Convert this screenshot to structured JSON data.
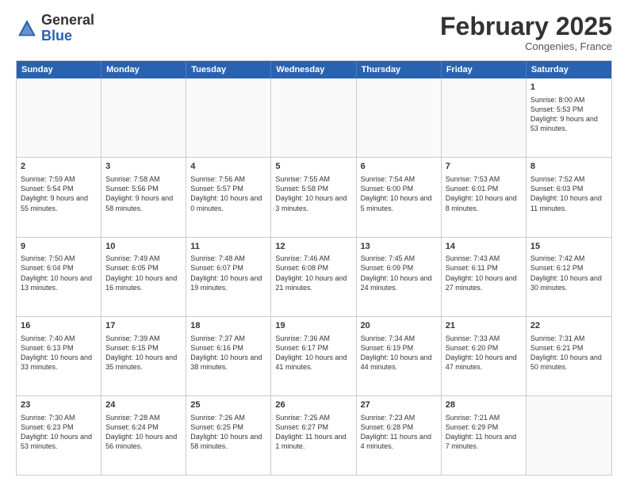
{
  "header": {
    "logo": {
      "general": "General",
      "blue": "Blue"
    },
    "title": "February 2025",
    "location": "Congenies, France"
  },
  "weekdays": [
    "Sunday",
    "Monday",
    "Tuesday",
    "Wednesday",
    "Thursday",
    "Friday",
    "Saturday"
  ],
  "weeks": [
    [
      {
        "day": "",
        "empty": true
      },
      {
        "day": "",
        "empty": true
      },
      {
        "day": "",
        "empty": true
      },
      {
        "day": "",
        "empty": true
      },
      {
        "day": "",
        "empty": true
      },
      {
        "day": "",
        "empty": true
      },
      {
        "day": "1",
        "sunrise": "Sunrise: 8:00 AM",
        "sunset": "Sunset: 5:53 PM",
        "daylight": "Daylight: 9 hours and 53 minutes."
      }
    ],
    [
      {
        "day": "2",
        "sunrise": "Sunrise: 7:59 AM",
        "sunset": "Sunset: 5:54 PM",
        "daylight": "Daylight: 9 hours and 55 minutes."
      },
      {
        "day": "3",
        "sunrise": "Sunrise: 7:58 AM",
        "sunset": "Sunset: 5:56 PM",
        "daylight": "Daylight: 9 hours and 58 minutes."
      },
      {
        "day": "4",
        "sunrise": "Sunrise: 7:56 AM",
        "sunset": "Sunset: 5:57 PM",
        "daylight": "Daylight: 10 hours and 0 minutes."
      },
      {
        "day": "5",
        "sunrise": "Sunrise: 7:55 AM",
        "sunset": "Sunset: 5:58 PM",
        "daylight": "Daylight: 10 hours and 3 minutes."
      },
      {
        "day": "6",
        "sunrise": "Sunrise: 7:54 AM",
        "sunset": "Sunset: 6:00 PM",
        "daylight": "Daylight: 10 hours and 5 minutes."
      },
      {
        "day": "7",
        "sunrise": "Sunrise: 7:53 AM",
        "sunset": "Sunset: 6:01 PM",
        "daylight": "Daylight: 10 hours and 8 minutes."
      },
      {
        "day": "8",
        "sunrise": "Sunrise: 7:52 AM",
        "sunset": "Sunset: 6:03 PM",
        "daylight": "Daylight: 10 hours and 11 minutes."
      }
    ],
    [
      {
        "day": "9",
        "sunrise": "Sunrise: 7:50 AM",
        "sunset": "Sunset: 6:04 PM",
        "daylight": "Daylight: 10 hours and 13 minutes."
      },
      {
        "day": "10",
        "sunrise": "Sunrise: 7:49 AM",
        "sunset": "Sunset: 6:05 PM",
        "daylight": "Daylight: 10 hours and 16 minutes."
      },
      {
        "day": "11",
        "sunrise": "Sunrise: 7:48 AM",
        "sunset": "Sunset: 6:07 PM",
        "daylight": "Daylight: 10 hours and 19 minutes."
      },
      {
        "day": "12",
        "sunrise": "Sunrise: 7:46 AM",
        "sunset": "Sunset: 6:08 PM",
        "daylight": "Daylight: 10 hours and 21 minutes."
      },
      {
        "day": "13",
        "sunrise": "Sunrise: 7:45 AM",
        "sunset": "Sunset: 6:09 PM",
        "daylight": "Daylight: 10 hours and 24 minutes."
      },
      {
        "day": "14",
        "sunrise": "Sunrise: 7:43 AM",
        "sunset": "Sunset: 6:11 PM",
        "daylight": "Daylight: 10 hours and 27 minutes."
      },
      {
        "day": "15",
        "sunrise": "Sunrise: 7:42 AM",
        "sunset": "Sunset: 6:12 PM",
        "daylight": "Daylight: 10 hours and 30 minutes."
      }
    ],
    [
      {
        "day": "16",
        "sunrise": "Sunrise: 7:40 AM",
        "sunset": "Sunset: 6:13 PM",
        "daylight": "Daylight: 10 hours and 33 minutes."
      },
      {
        "day": "17",
        "sunrise": "Sunrise: 7:39 AM",
        "sunset": "Sunset: 6:15 PM",
        "daylight": "Daylight: 10 hours and 35 minutes."
      },
      {
        "day": "18",
        "sunrise": "Sunrise: 7:37 AM",
        "sunset": "Sunset: 6:16 PM",
        "daylight": "Daylight: 10 hours and 38 minutes."
      },
      {
        "day": "19",
        "sunrise": "Sunrise: 7:36 AM",
        "sunset": "Sunset: 6:17 PM",
        "daylight": "Daylight: 10 hours and 41 minutes."
      },
      {
        "day": "20",
        "sunrise": "Sunrise: 7:34 AM",
        "sunset": "Sunset: 6:19 PM",
        "daylight": "Daylight: 10 hours and 44 minutes."
      },
      {
        "day": "21",
        "sunrise": "Sunrise: 7:33 AM",
        "sunset": "Sunset: 6:20 PM",
        "daylight": "Daylight: 10 hours and 47 minutes."
      },
      {
        "day": "22",
        "sunrise": "Sunrise: 7:31 AM",
        "sunset": "Sunset: 6:21 PM",
        "daylight": "Daylight: 10 hours and 50 minutes."
      }
    ],
    [
      {
        "day": "23",
        "sunrise": "Sunrise: 7:30 AM",
        "sunset": "Sunset: 6:23 PM",
        "daylight": "Daylight: 10 hours and 53 minutes."
      },
      {
        "day": "24",
        "sunrise": "Sunrise: 7:28 AM",
        "sunset": "Sunset: 6:24 PM",
        "daylight": "Daylight: 10 hours and 56 minutes."
      },
      {
        "day": "25",
        "sunrise": "Sunrise: 7:26 AM",
        "sunset": "Sunset: 6:25 PM",
        "daylight": "Daylight: 10 hours and 58 minutes."
      },
      {
        "day": "26",
        "sunrise": "Sunrise: 7:25 AM",
        "sunset": "Sunset: 6:27 PM",
        "daylight": "Daylight: 11 hours and 1 minute."
      },
      {
        "day": "27",
        "sunrise": "Sunrise: 7:23 AM",
        "sunset": "Sunset: 6:28 PM",
        "daylight": "Daylight: 11 hours and 4 minutes."
      },
      {
        "day": "28",
        "sunrise": "Sunrise: 7:21 AM",
        "sunset": "Sunset: 6:29 PM",
        "daylight": "Daylight: 11 hours and 7 minutes."
      },
      {
        "day": "",
        "empty": true
      }
    ]
  ]
}
